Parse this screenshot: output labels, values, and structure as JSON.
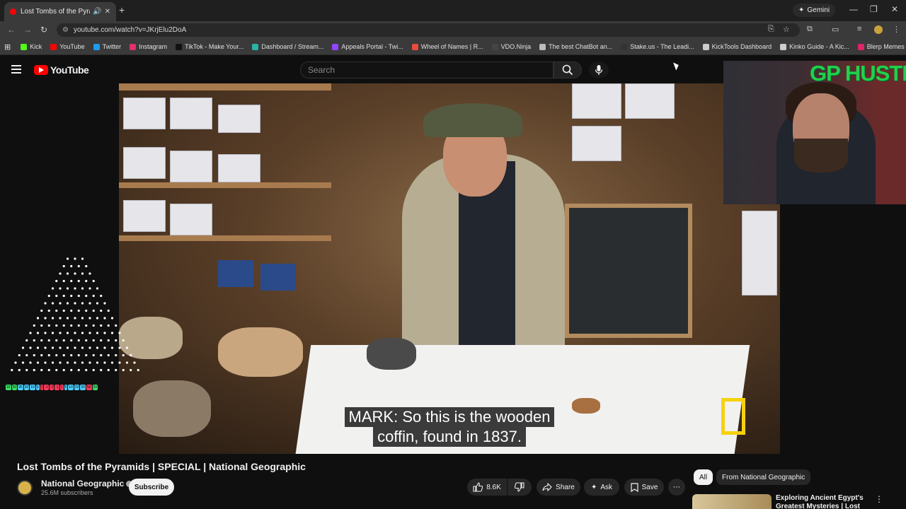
{
  "browser": {
    "tab_title": "Lost Tombs of the Pyramids",
    "url": "youtube.com/watch?v=JKrjElu2DoA",
    "gemini_label": "Gemini",
    "bookmarks": [
      {
        "label": "Kick",
        "color": "#53fc18"
      },
      {
        "label": "YouTube",
        "color": "#ff0000"
      },
      {
        "label": "Twitter",
        "color": "#1d9bf0"
      },
      {
        "label": "Instagram",
        "color": "#e1306c"
      },
      {
        "label": "TikTok - Make Your...",
        "color": "#111111"
      },
      {
        "label": "Dashboard / Stream...",
        "color": "#2ab3a6"
      },
      {
        "label": "Appeals Portal - Twi...",
        "color": "#9146ff"
      },
      {
        "label": "Wheel of Names | R...",
        "color": "#e94b3c"
      },
      {
        "label": "VDO.Ninja",
        "color": "#444444"
      },
      {
        "label": "The best ChatBot an...",
        "color": "#bbbbbb"
      },
      {
        "label": "Stake.us - The Leadi...",
        "color": "#333333"
      },
      {
        "label": "KickTools Dashboard",
        "color": "#cccccc"
      },
      {
        "label": "Kinko Guide - A Kic...",
        "color": "#cccccc"
      },
      {
        "label": "Blerp Memes | Best...",
        "color": "#e0246a"
      }
    ]
  },
  "youtube": {
    "logo_text": "YouTube",
    "search_placeholder": "Search"
  },
  "video": {
    "subtitle_line1": "MARK: So this is the wooden",
    "subtitle_line2": "coffin, found in 1837.",
    "overlay_counters": [
      "10",
      "20",
      "35",
      "20",
      "10",
      "5",
      "1",
      "-1",
      "-2",
      "-1",
      "1",
      "5",
      "10",
      "20",
      "35",
      "50",
      "20"
    ]
  },
  "webcam": {
    "overlay_text": "GP HUSTLA"
  },
  "details": {
    "title": "Lost Tombs of the Pyramids | SPECIAL | National Geographic",
    "channel": "National Geographic",
    "subscribers": "25.6M subscribers",
    "subscribe_label": "Subscribe",
    "likes": "8.6K",
    "share_label": "Share",
    "ask_label": "Ask",
    "save_label": "Save"
  },
  "sidebar": {
    "chips": [
      "All",
      "From National Geographic"
    ],
    "rec_title": "Exploring Ancient Egypt's Greatest Mysteries | Lost"
  },
  "colors": {
    "accent_red": "#ff0000",
    "natgeo_yellow": "#f5d20d",
    "overlay_green": "#1fd14a"
  }
}
